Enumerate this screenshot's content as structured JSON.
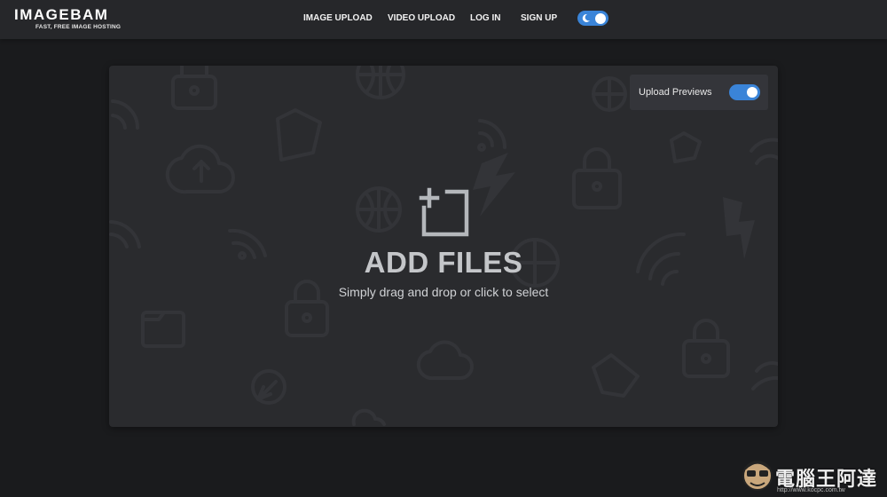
{
  "header": {
    "logo_title": "IMAGEBAM",
    "logo_tagline": "FAST, FREE IMAGE HOSTING",
    "nav": {
      "image_upload": "IMAGE UPLOAD",
      "video_upload": "VIDEO UPLOAD",
      "log_in": "LOG IN",
      "sign_up": "SIGN UP"
    },
    "theme_toggle": {
      "icon": "moon-icon",
      "state": "on"
    }
  },
  "uploader": {
    "preview_label": "Upload Previews",
    "preview_toggle_state": "on",
    "icon": "add-image-icon",
    "title": "ADD FILES",
    "subtitle": "Simply drag and drop or click to select",
    "background_icons": [
      "lock-icon",
      "globe-icon",
      "wifi-icon",
      "folder-icon",
      "cloud-upload-icon",
      "lightning-icon"
    ]
  },
  "watermark": {
    "text": "電腦王阿達",
    "url": "http://www.kocpc.com.tw"
  },
  "colors": {
    "page_bg": "#1a1b1d",
    "header_bg": "#26272a",
    "panel_bg": "#2a2b2e",
    "accent": "#3a84d8"
  }
}
